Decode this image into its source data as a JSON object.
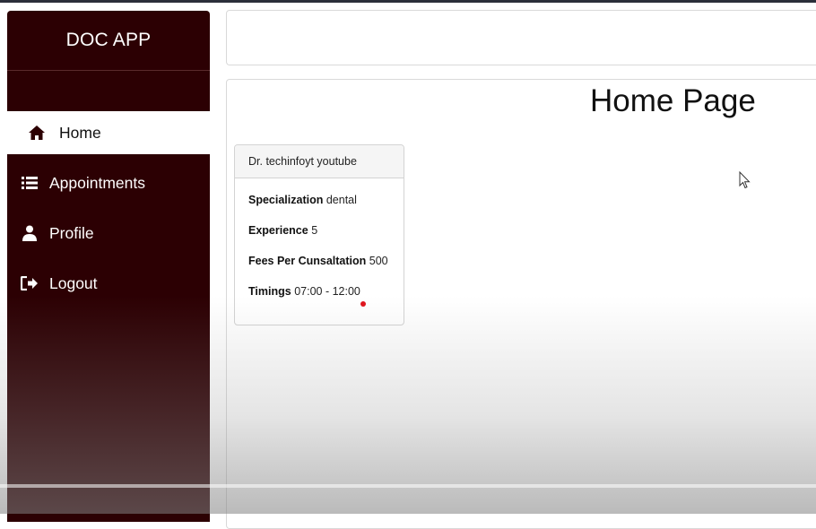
{
  "sidebar": {
    "brand": "DOC APP",
    "items": [
      {
        "label": "Home",
        "icon": "home-icon",
        "active": true
      },
      {
        "label": "Appointments",
        "icon": "list-icon",
        "active": false
      },
      {
        "label": "Profile",
        "icon": "user-icon",
        "active": false
      },
      {
        "label": "Logout",
        "icon": "logout-icon",
        "active": false
      }
    ]
  },
  "main": {
    "title": "Home Page",
    "doctor_card": {
      "name": "Dr. techinfoyt youtube",
      "specialization_label": "Specialization",
      "specialization": "dental",
      "experience_label": "Experience",
      "experience": "5",
      "fees_label": "Fees Per Cunsaltation",
      "fees": "500",
      "timings_label": "Timings",
      "timings": "07:00 - 12:00"
    }
  },
  "colors": {
    "sidebar_bg": "#2c0003",
    "active_item_bg": "#ffffff",
    "accent_dot": "#e0141c"
  }
}
